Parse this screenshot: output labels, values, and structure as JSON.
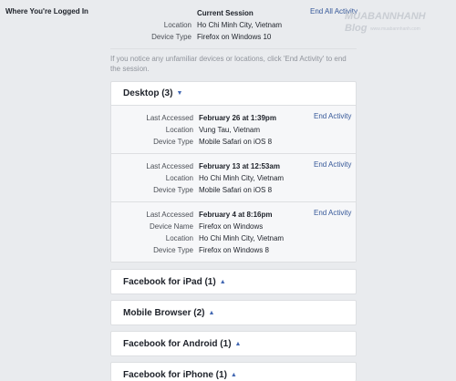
{
  "section_label": "Where You're Logged In",
  "current": {
    "rows": [
      {
        "key": "",
        "value": "Current Session"
      },
      {
        "key": "Location",
        "value": "Ho Chi Minh City, Vietnam"
      },
      {
        "key": "Device Type",
        "value": "Firefox on Windows 10"
      }
    ],
    "end_all_label": "End All Activity"
  },
  "notice": "If you notice any unfamiliar devices or locations, click 'End Activity' to end the session.",
  "desktop": {
    "title": "Desktop (3)",
    "end_label": "End Activity",
    "sessions": [
      {
        "rows": [
          {
            "key": "Last Accessed",
            "value": "February 26 at 1:39pm"
          },
          {
            "key": "Location",
            "value": "Vung Tau, Vietnam"
          },
          {
            "key": "Device Type",
            "value": "Mobile Safari on iOS 8"
          }
        ]
      },
      {
        "rows": [
          {
            "key": "Last Accessed",
            "value": "February 13 at 12:53am"
          },
          {
            "key": "Location",
            "value": "Ho Chi Minh City, Vietnam"
          },
          {
            "key": "Device Type",
            "value": "Mobile Safari on iOS 8"
          }
        ]
      },
      {
        "rows": [
          {
            "key": "Last Accessed",
            "value": "February 4 at 8:16pm"
          },
          {
            "key": "Device Name",
            "value": "Firefox on Windows"
          },
          {
            "key": "Location",
            "value": "Ho Chi Minh City, Vietnam"
          },
          {
            "key": "Device Type",
            "value": "Firefox on Windows 8"
          }
        ]
      }
    ]
  },
  "groups": [
    {
      "title": "Facebook for iPad (1)"
    },
    {
      "title": "Mobile Browser (2)"
    },
    {
      "title": "Facebook for Android (1)"
    },
    {
      "title": "Facebook for iPhone (1)"
    }
  ],
  "watermark": {
    "line1": "MUABANNHANH",
    "line2": "Blog",
    "url": "www.muabannhanh.com"
  },
  "colors": {
    "link": "#365899",
    "caret": "#4267b2",
    "background": "#e9ebee"
  },
  "icons": {
    "collapsed": "caret-down-icon",
    "expanded": "caret-up-icon"
  }
}
